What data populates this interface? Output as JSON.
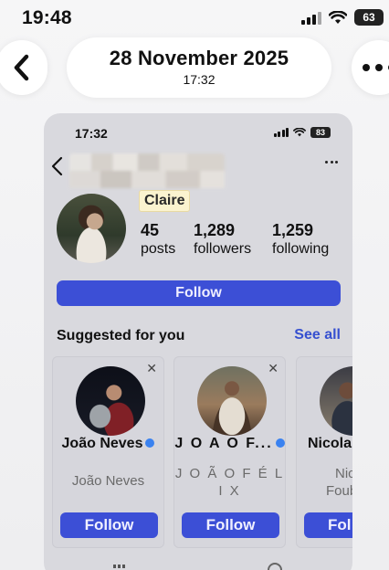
{
  "status_bar": {
    "time": "19:48",
    "battery": "63"
  },
  "header": {
    "date": "28 November 2025",
    "time": "17:32"
  },
  "screenshot": {
    "status_time": "17:32",
    "battery": "83",
    "tag": "Claire",
    "stats": [
      {
        "value": "45",
        "label": "posts"
      },
      {
        "value": "1,289",
        "label": "followers"
      },
      {
        "value": "1,259",
        "label": "following"
      }
    ],
    "follow_label": "Follow",
    "suggested": {
      "title": "Suggested for you",
      "see_all": "See all",
      "cards": [
        {
          "name": "João Neves",
          "subtitle": "João Neves",
          "button": "Follow",
          "verified": true
        },
        {
          "name": "J O A O F...",
          "subtitle_line1": "J O Ã O  F É L",
          "subtitle_line2": "I X",
          "button": "Follow",
          "verified": true
        },
        {
          "name": "Nicola",
          "subtitle_line1": "Nic",
          "subtitle_line2": "Foub",
          "button": "Fol",
          "verified": false
        }
      ]
    }
  },
  "colors": {
    "accent": "#3c4fd6",
    "link": "#3650d0",
    "verified": "#3a82f0"
  }
}
